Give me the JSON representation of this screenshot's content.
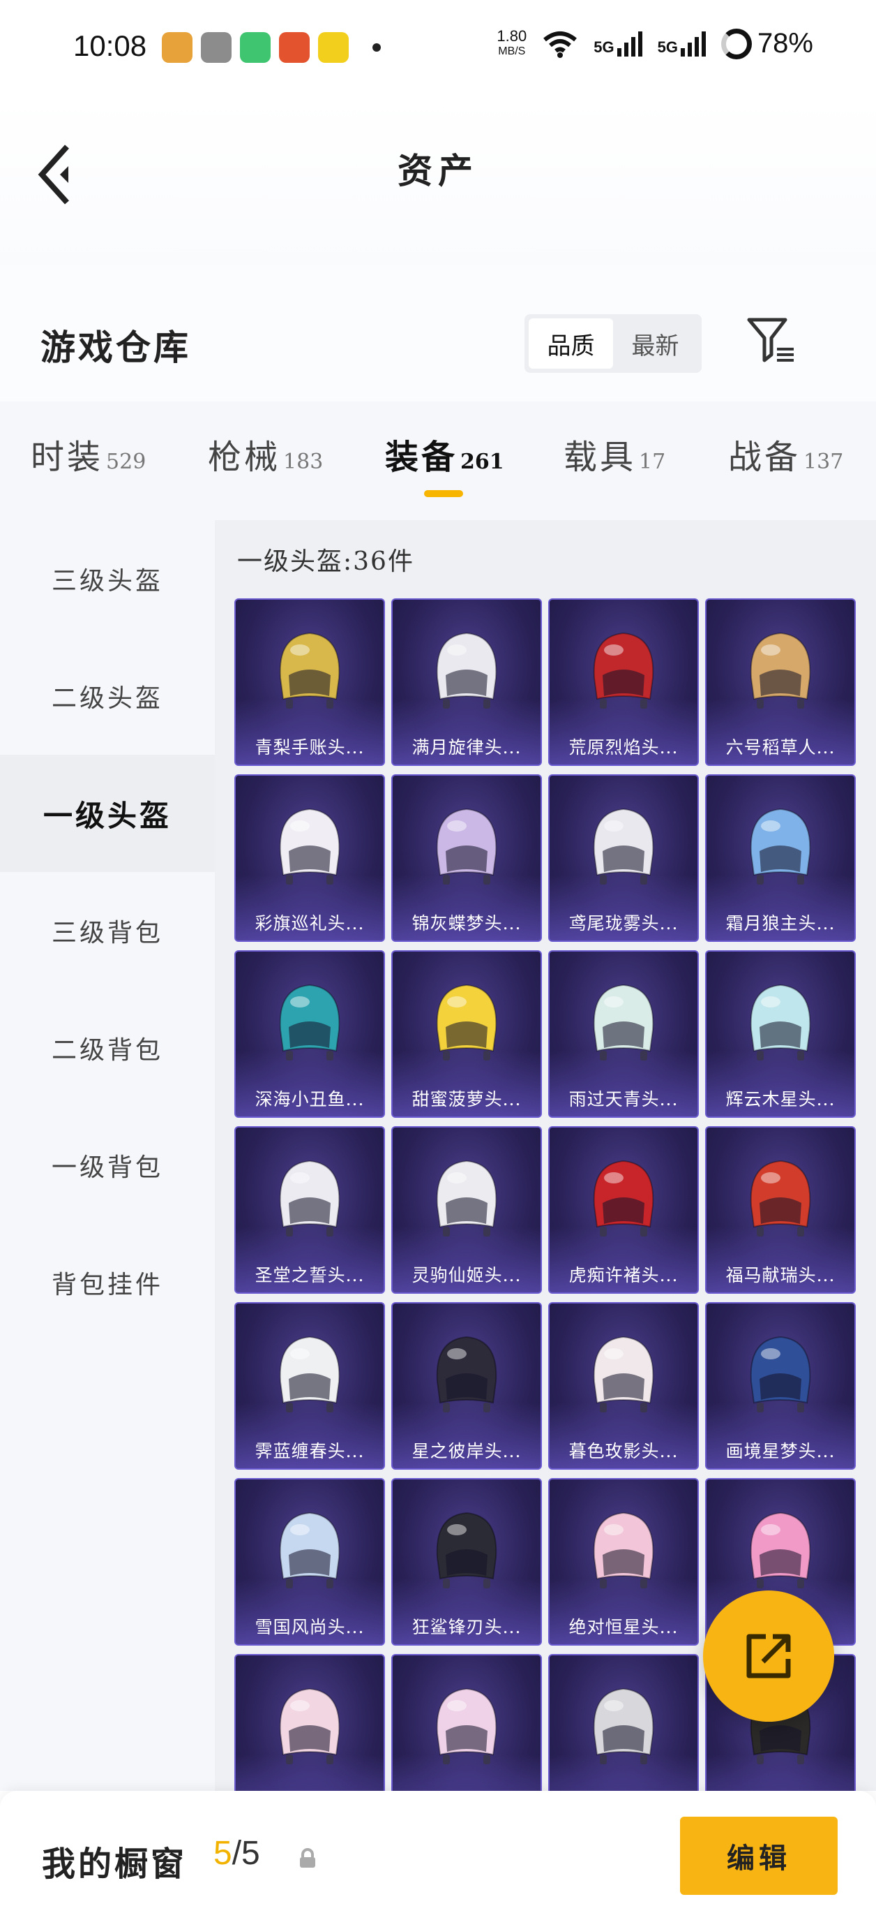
{
  "status_bar": {
    "time": "10:08",
    "speed_value": "1.80",
    "speed_unit": "MB/S",
    "signal1": "5G",
    "signal2": "5G",
    "battery": "78%",
    "app_icon_colors": [
      "#e8a23a",
      "#8c8c8c",
      "#3fc46f",
      "#e3542e",
      "#f3cf1d"
    ]
  },
  "header": {
    "title": "资产"
  },
  "warehouse": {
    "title": "游戏仓库",
    "sort_options": [
      "品质",
      "最新"
    ],
    "active_sort": "品质"
  },
  "tabs": [
    {
      "name": "时装",
      "count": "529"
    },
    {
      "name": "枪械",
      "count": "183"
    },
    {
      "name": "装备",
      "count": "261",
      "active": true
    },
    {
      "name": "载具",
      "count": "17"
    },
    {
      "name": "战备",
      "count": "137"
    }
  ],
  "side_menu": [
    {
      "label": "三级头盔"
    },
    {
      "label": "二级头盔"
    },
    {
      "label": "一级头盔",
      "active": true
    },
    {
      "label": "三级背包"
    },
    {
      "label": "二级背包"
    },
    {
      "label": "一级背包"
    },
    {
      "label": "背包挂件"
    }
  ],
  "content": {
    "heading": "一级头盔:36件",
    "items": [
      {
        "name": "青梨手账头...",
        "color": "#d8b84a"
      },
      {
        "name": "满月旋律头...",
        "color": "#e9e9ef"
      },
      {
        "name": "荒原烈焰头...",
        "color": "#c0282c"
      },
      {
        "name": "六号稻草人...",
        "color": "#d6a86a"
      },
      {
        "name": "彩旗巡礼头...",
        "color": "#f0eef4"
      },
      {
        "name": "锦灰蝶梦头...",
        "color": "#cbb8e6"
      },
      {
        "name": "鸢尾珑雾头...",
        "color": "#e8e8ee"
      },
      {
        "name": "霜月狼主头...",
        "color": "#7fb2e8"
      },
      {
        "name": "深海小丑鱼...",
        "color": "#2ea3b0"
      },
      {
        "name": "甜蜜菠萝头...",
        "color": "#f3d23c"
      },
      {
        "name": "雨过天青头...",
        "color": "#d9ece8"
      },
      {
        "name": "辉云木星头...",
        "color": "#bfe6ec"
      },
      {
        "name": "圣堂之誓头...",
        "color": "#ecebf2"
      },
      {
        "name": "灵驹仙姬头...",
        "color": "#ecebf0"
      },
      {
        "name": "虎痴许褚头...",
        "color": "#c8252a"
      },
      {
        "name": "福马献瑞头...",
        "color": "#d23c2a"
      },
      {
        "name": "霁蓝缠春头...",
        "color": "#eef0f2"
      },
      {
        "name": "星之彼岸头...",
        "color": "#2d2a3a"
      },
      {
        "name": "暮色玫影头...",
        "color": "#f0e8ea"
      },
      {
        "name": "画境星梦头...",
        "color": "#2f4f98"
      },
      {
        "name": "雪国风尚头...",
        "color": "#c6d8f0"
      },
      {
        "name": "狂鲨锋刃头...",
        "color": "#2a2b34"
      },
      {
        "name": "绝对恒星头...",
        "color": "#f2c6d8"
      },
      {
        "name": "",
        "color": "#f19ac8"
      },
      {
        "name": "",
        "color": "#f2d6e2"
      },
      {
        "name": "",
        "color": "#efd2e8"
      },
      {
        "name": "",
        "color": "#d8d8dc"
      },
      {
        "name": "",
        "color": "#2c2a28"
      }
    ]
  },
  "bottom_bar": {
    "label": "我的橱窗",
    "current": "5",
    "total": "/5",
    "edit_label": "编辑"
  }
}
